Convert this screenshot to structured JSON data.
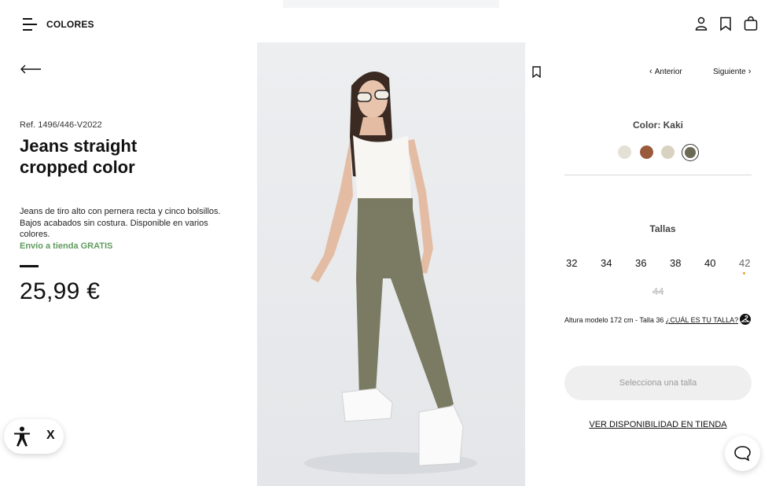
{
  "header": {
    "brand": "COLORES",
    "icons": [
      "menu-icon",
      "user-icon",
      "bookmark-icon",
      "bag-icon"
    ]
  },
  "product": {
    "reference": "Ref. 1496/446-V2022",
    "title": "Jeans straight cropped color",
    "description": "Jeans de tiro alto con pernera recta y cinco bolsillos. Bajos acabados sin costura. Disponible en varios colores.",
    "shipping": "Envío a tienda GRATIS",
    "price": "25,99 €"
  },
  "navigation": {
    "prev_label": "Anterior",
    "next_label": "Siguiente"
  },
  "color": {
    "label": "Color: Kaki",
    "swatches": [
      "#e4e0d5",
      "#9a5a3c",
      "#d9d2c1",
      "#6b6a55"
    ],
    "selected_index": 3
  },
  "sizes": {
    "label": "Tallas",
    "items": [
      "32",
      "34",
      "36",
      "38",
      "40",
      "42"
    ],
    "unavailable": "44"
  },
  "model": {
    "info": "Altura modelo 172 cm - Talla 36",
    "link": "¿CUÁL ES TU TALLA?"
  },
  "actions": {
    "select_size": "Selecciona una talla",
    "store_availability": "VER DISPONIBILIDAD EN TIENDA"
  },
  "accessibility": {
    "close_label": "X"
  },
  "colors": {
    "accent_green": "#5e9b5e",
    "text": "#111111",
    "button_bg": "#efefef",
    "low_stock_dot": "#f0a030"
  }
}
